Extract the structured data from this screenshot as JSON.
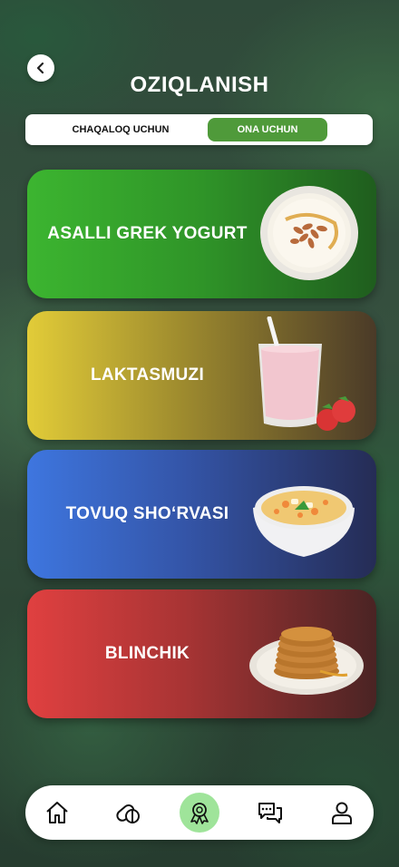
{
  "header": {
    "title": "OZIQLANISH",
    "back_icon": "chevron-left-icon"
  },
  "tabs": [
    {
      "label": "CHAQALOQ UCHUN",
      "active": false
    },
    {
      "label": "ONA UCHUN",
      "active": true
    }
  ],
  "colors": {
    "accent": "#4f9a3a",
    "active_nav": "#9fe49a"
  },
  "cards": [
    {
      "label": "ASALLI GREK YOGURT",
      "image": "yogurt-bowl-icon"
    },
    {
      "label": "LAKTASMUZI",
      "image": "smoothie-glass-icon"
    },
    {
      "label": "TOVUQ SHO‘RVASI",
      "image": "soup-bowl-icon"
    },
    {
      "label": "BLINCHIK",
      "image": "pancakes-icon"
    }
  ],
  "nav": [
    {
      "icon": "home-icon",
      "active": false
    },
    {
      "icon": "pills-icon",
      "active": false
    },
    {
      "icon": "award-icon",
      "active": true
    },
    {
      "icon": "chat-icon",
      "active": false
    },
    {
      "icon": "profile-icon",
      "active": false
    }
  ]
}
